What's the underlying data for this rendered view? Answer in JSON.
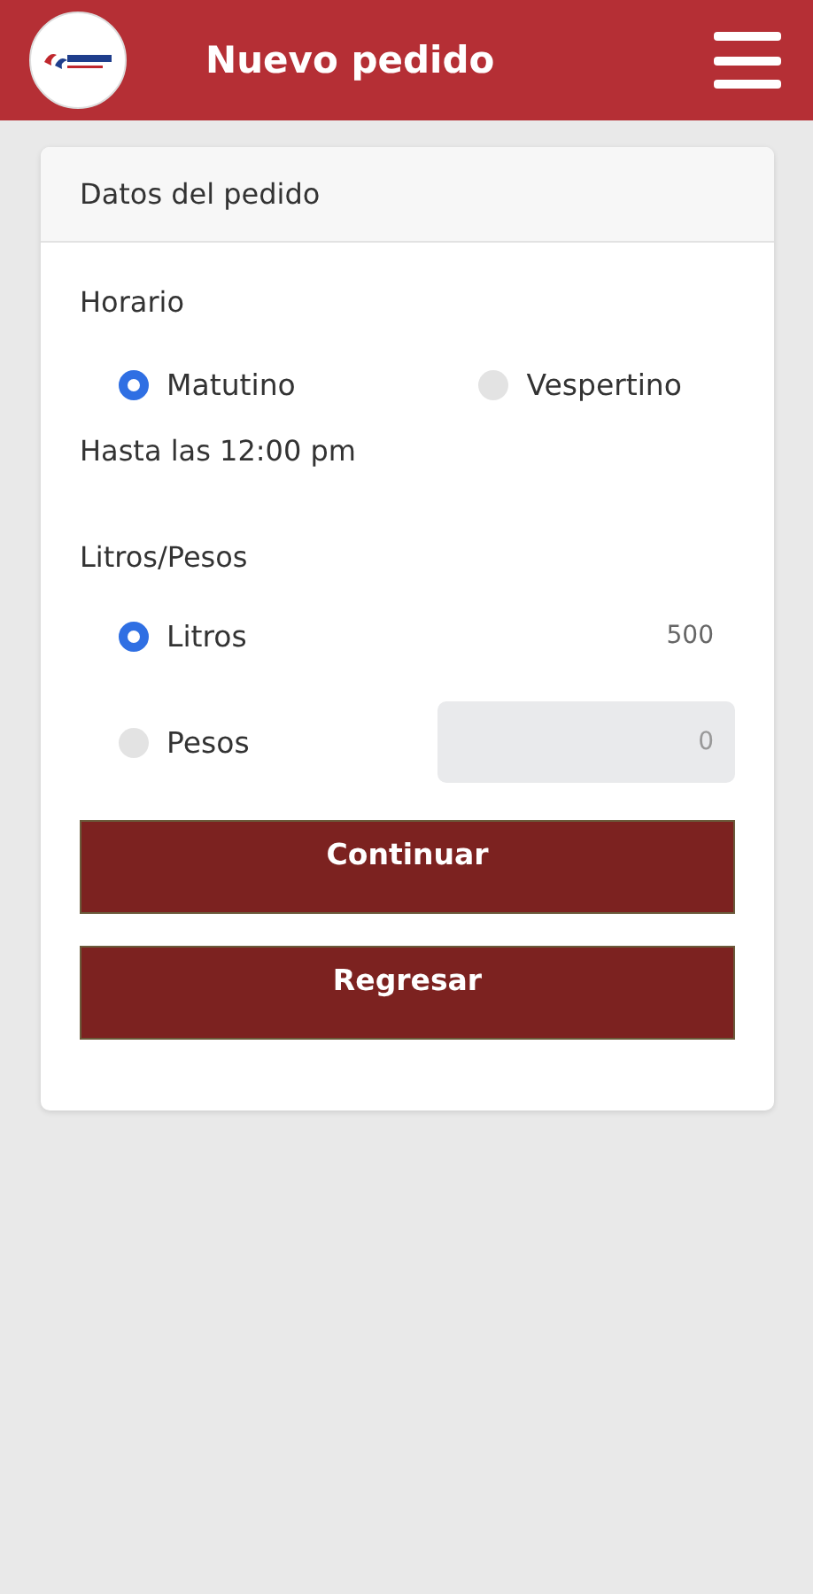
{
  "header": {
    "title": "Nuevo pedido"
  },
  "card": {
    "title": "Datos del pedido"
  },
  "schedule": {
    "label": "Horario",
    "options": [
      {
        "label": "Matutino",
        "selected": true
      },
      {
        "label": "Vespertino",
        "selected": false
      }
    ],
    "note": "Hasta las 12:00 pm"
  },
  "amount": {
    "label": "Litros/Pesos",
    "options": [
      {
        "label": "Litros",
        "selected": true,
        "value": "500",
        "disabled": false
      },
      {
        "label": "Pesos",
        "selected": false,
        "value": "0",
        "disabled": true
      }
    ]
  },
  "buttons": [
    "Continuar",
    "Regresar"
  ]
}
